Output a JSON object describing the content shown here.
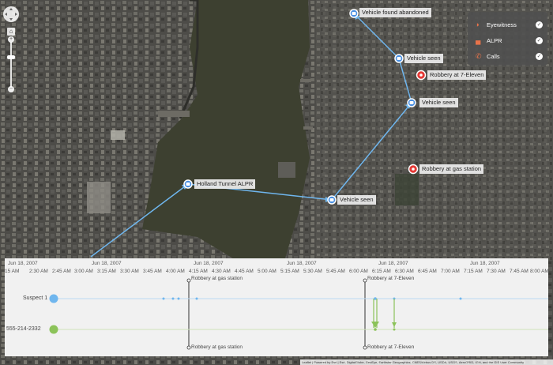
{
  "legend": {
    "items": [
      {
        "icon": "ear-icon",
        "label": "Eyewitness",
        "color": "#e8734a"
      },
      {
        "icon": "car-icon",
        "label": "ALPR",
        "color": "#e8734a"
      },
      {
        "icon": "phone-icon",
        "label": "Calls",
        "color": "#e8734a"
      }
    ]
  },
  "map": {
    "markers": [
      {
        "label": "Vehicle found abandoned",
        "kind": "alpr"
      },
      {
        "label": "Vehicle seen",
        "kind": "alpr"
      },
      {
        "label": "Robbery at 7-Eleven",
        "kind": "robbery"
      },
      {
        "label": "Vehicle seen",
        "kind": "alpr"
      },
      {
        "label": "Robbery at gas station",
        "kind": "robbery"
      },
      {
        "label": "Holland Tunnel ALPR",
        "kind": "alpr"
      },
      {
        "label": "Vehicle seen",
        "kind": "alpr"
      }
    ],
    "zoom_home": "⌂",
    "zoom_in": "+",
    "zoom_out": "−"
  },
  "timeline": {
    "dates": [
      "Jun 18, 2007",
      "Jun 18, 2007",
      "Jun 18, 2007",
      "Jun 18, 2007",
      "Jun 18, 2007",
      "Jun 18, 2007"
    ],
    "times": [
      "15 AM",
      "2:30 AM",
      "2:45 AM",
      "3:00 AM",
      "3:15 AM",
      "3:30 AM",
      "3:45 AM",
      "4:00 AM",
      "4:15 AM",
      "4:30 AM",
      "4:45 AM",
      "5:00 AM",
      "5:15 AM",
      "5:30 AM",
      "5:45 AM",
      "6:00 AM",
      "6:15 AM",
      "6:30 AM",
      "6:45 AM",
      "7:00 AM",
      "7:15 AM",
      "7:30 AM",
      "7:45 AM",
      "8:00 AM"
    ],
    "events": [
      {
        "label": "Robbery at gas station"
      },
      {
        "label": "Robbery at 7-Eleven"
      }
    ],
    "rows": [
      {
        "label": "Suspect 1",
        "color": "#6fb6ee"
      },
      {
        "label": "555-214-2332",
        "color": "#8cc35a"
      }
    ]
  },
  "attribution": "Leaflet | Powered by Esri | Esri, DigitalGlobe, GeoEye, Earthstar Geographics, CNES/Airbus DS, USDA, USGS, AeroGRID, IGN, and the GIS User Community"
}
